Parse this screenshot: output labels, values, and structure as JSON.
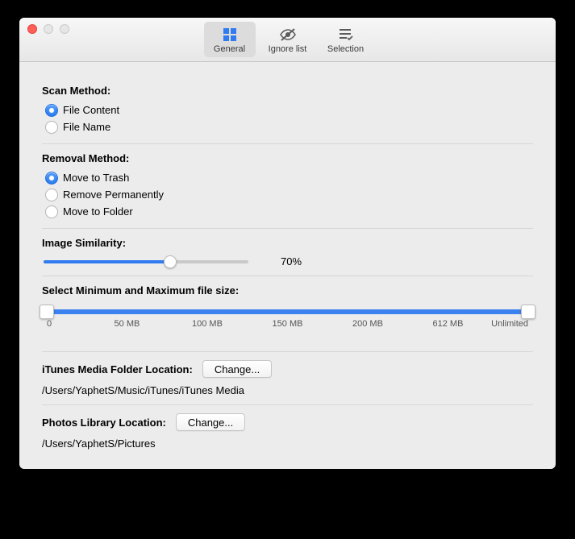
{
  "toolbar": {
    "general": "General",
    "ignore": "Ignore list",
    "selection": "Selection"
  },
  "scan": {
    "title": "Scan Method:",
    "options": [
      "File Content",
      "File Name"
    ],
    "selected": 0
  },
  "removal": {
    "title": "Removal Method:",
    "options": [
      "Move to Trash",
      "Remove Permanently",
      "Move to Folder"
    ],
    "selected": 0
  },
  "similarity": {
    "title": "Image Similarity:",
    "percent": 70,
    "display": "70%"
  },
  "filesize": {
    "title": "Select Minimum and Maximum file size:",
    "ticks": [
      "0",
      "50 MB",
      "100 MB",
      "150 MB",
      "200 MB",
      "612 MB",
      "Unlimited"
    ],
    "tick_positions": [
      0,
      16.66,
      33.33,
      50,
      66.66,
      83.33,
      100
    ],
    "min_pos": 0,
    "max_pos": 100
  },
  "itunes": {
    "title": "iTunes Media Folder Location:",
    "button": "Change...",
    "path": "/Users/YaphetS/Music/iTunes/iTunes Media"
  },
  "photos": {
    "title": "Photos Library Location:",
    "button": "Change...",
    "path": "/Users/YaphetS/Pictures"
  }
}
